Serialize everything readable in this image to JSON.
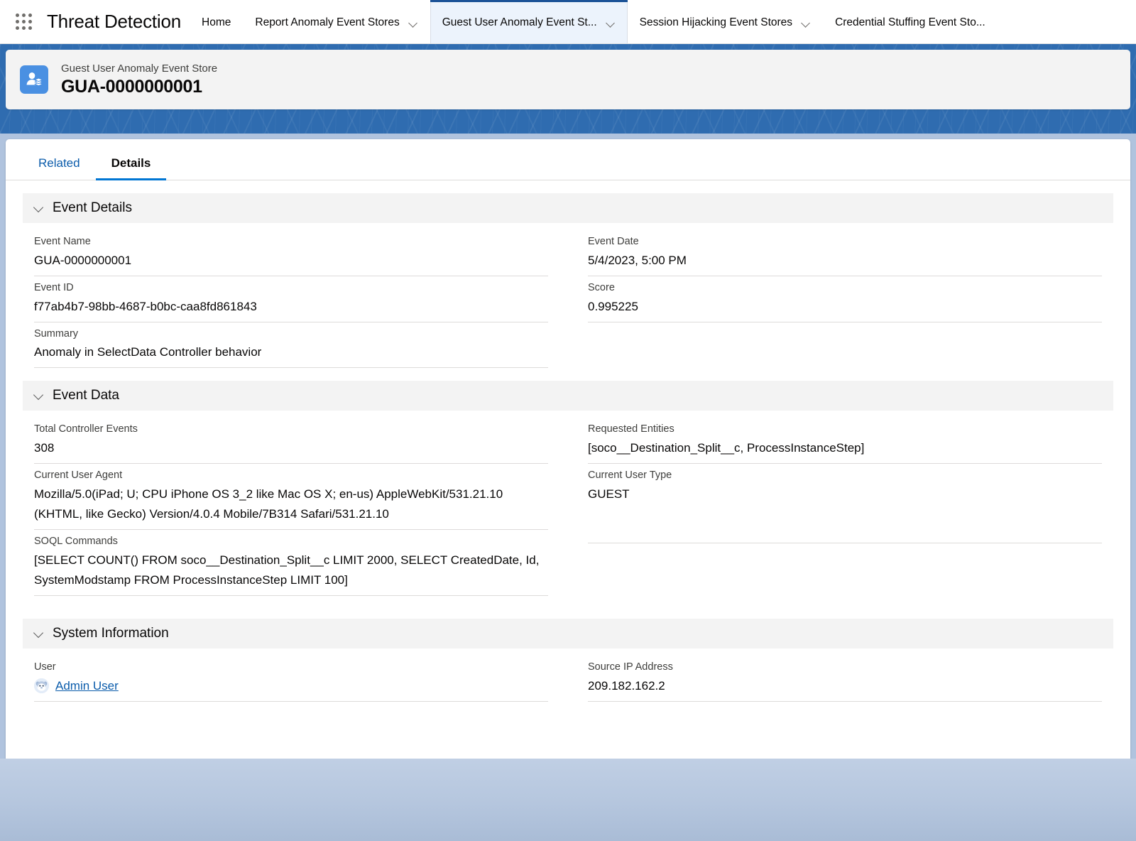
{
  "global_nav": {
    "app_launcher_icon": "waffle-grid-icon",
    "app_name": "Threat Detection",
    "items": [
      {
        "label": "Home",
        "has_menu": false,
        "active": false
      },
      {
        "label": "Report Anomaly Event Stores",
        "has_menu": true,
        "active": false
      },
      {
        "label": "Guest User Anomaly Event St...",
        "has_menu": true,
        "active": true
      },
      {
        "label": "Session Hijacking Event Stores",
        "has_menu": true,
        "active": false
      },
      {
        "label": "Credential Stuffing Event Sto...",
        "has_menu": false,
        "active": false
      }
    ]
  },
  "record_header": {
    "icon": "guest-user-anomaly-event-store-icon",
    "object_label": "Guest User Anomaly Event Store",
    "record_name": "GUA-0000000001"
  },
  "tabs": [
    {
      "label": "Related",
      "active": false
    },
    {
      "label": "Details",
      "active": true
    }
  ],
  "sections": {
    "event_details": {
      "title": "Event Details",
      "left": [
        {
          "label": "Event Name",
          "value": "GUA-0000000001"
        },
        {
          "label": "Event ID",
          "value": "f77ab4b7-98bb-4687-b0bc-caa8fd861843"
        },
        {
          "label": "Summary",
          "value": "Anomaly in SelectData Controller behavior"
        }
      ],
      "right": [
        {
          "label": "Event Date",
          "value": "5/4/2023, 5:00 PM"
        },
        {
          "label": "Score",
          "value": "0.995225"
        }
      ]
    },
    "event_data": {
      "title": "Event Data",
      "left": [
        {
          "label": "Total Controller Events",
          "value": "308"
        },
        {
          "label": "Current User Agent",
          "value": "Mozilla/5.0(iPad; U; CPU iPhone OS 3_2 like Mac OS X; en-us) AppleWebKit/531.21.10 (KHTML, like Gecko) Version/4.0.4 Mobile/7B314 Safari/531.21.10"
        },
        {
          "label": "SOQL Commands",
          "value": "[SELECT COUNT() FROM soco__Destination_Split__c LIMIT 2000, SELECT CreatedDate, Id, SystemModstamp FROM ProcessInstanceStep LIMIT 100]"
        }
      ],
      "right": [
        {
          "label": "Requested Entities",
          "value": "[soco__Destination_Split__c, ProcessInstanceStep]"
        },
        {
          "label": "Current User Type",
          "value": "GUEST"
        }
      ]
    },
    "system_information": {
      "title": "System Information",
      "left": [
        {
          "label": "User",
          "value": "Admin User",
          "type": "user-link",
          "avatar": "astro-avatar-icon"
        }
      ],
      "right": [
        {
          "label": "Source IP Address",
          "value": "209.182.162.2"
        }
      ]
    }
  },
  "colors": {
    "brand_blue": "#0176d3",
    "banner_blue": "#2f6cb0",
    "link_blue": "#0b5cab",
    "active_tab_bg": "#ecf3fc",
    "section_header_bg": "#f3f3f3",
    "page_bg": "#b0c3de"
  }
}
